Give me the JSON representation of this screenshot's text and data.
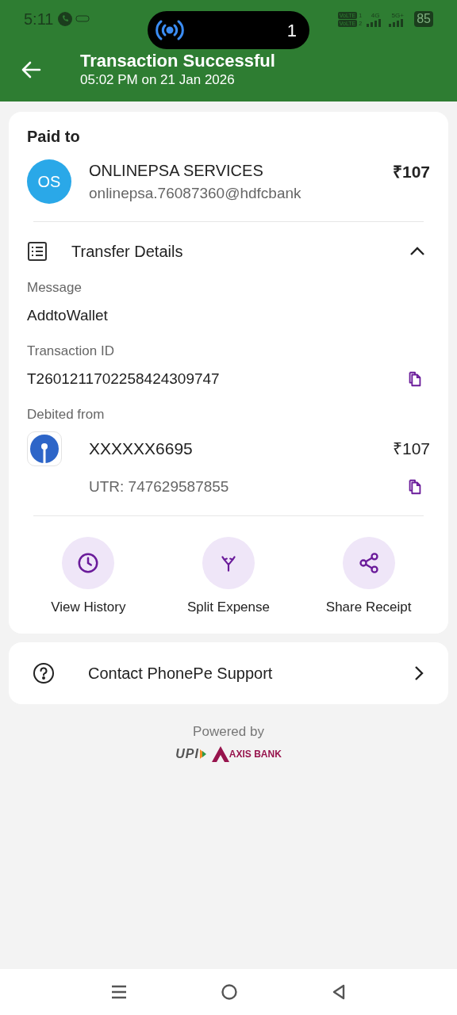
{
  "status_bar": {
    "time": "5:11",
    "pill_count": "1",
    "sim_labels": [
      "VoLTE",
      "VoLTE"
    ],
    "sim_numbers": [
      "1",
      "2"
    ],
    "networks": [
      "4G",
      "5G+"
    ],
    "battery": "85"
  },
  "header": {
    "title": "Transaction Successful",
    "subtitle": "05:02 PM on 21 Jan 2026"
  },
  "paid_to": {
    "heading": "Paid to",
    "initials": "OS",
    "name": "ONLINEPSA SERVICES",
    "upi_id": "onlinepsa.76087360@hdfcbank",
    "amount": "₹107"
  },
  "transfer_details": {
    "title": "Transfer Details",
    "expanded": true,
    "fields": [
      {
        "label": "Message",
        "value": "AddtoWallet",
        "copyable": false
      },
      {
        "label": "Transaction ID",
        "value": "T2601211702258424309747",
        "copyable": true
      }
    ],
    "debited": {
      "label": "Debited from",
      "account": "XXXXXX6695",
      "amount": "₹107",
      "utr": "UTR: 747629587855"
    }
  },
  "actions": [
    {
      "kind": "history",
      "label": "View History"
    },
    {
      "kind": "split",
      "label": "Split Expense"
    },
    {
      "kind": "share",
      "label": "Share Receipt"
    }
  ],
  "support": {
    "label": "Contact PhonePe Support"
  },
  "footer": {
    "powered_by": "Powered by",
    "upi": "UPI",
    "bank": "AXIS BANK"
  }
}
